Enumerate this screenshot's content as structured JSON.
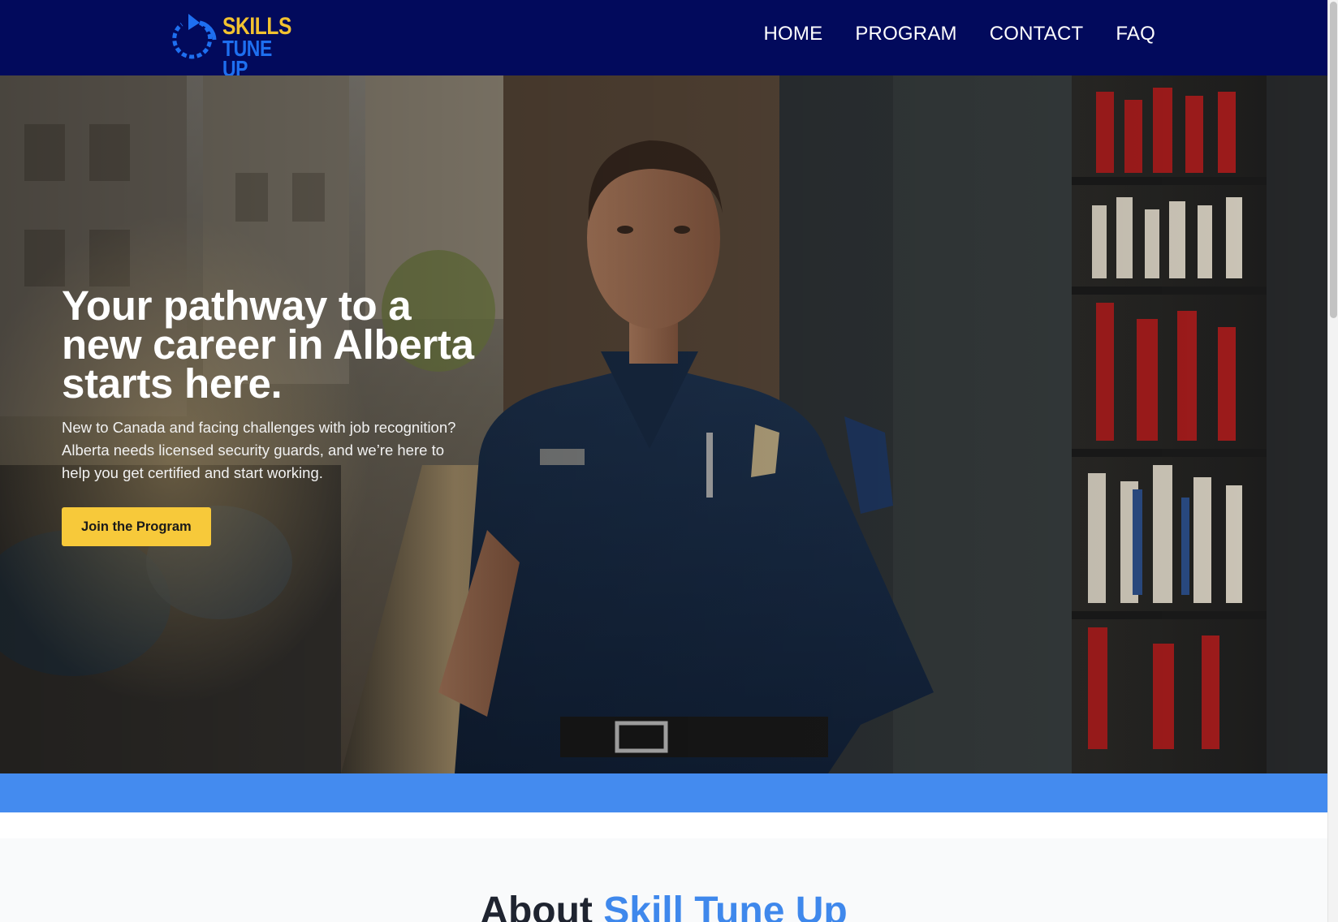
{
  "header": {
    "logo": {
      "line1": "SKILLS",
      "line2": "TUNE UP",
      "icon": "circular-arrow-icon"
    },
    "nav": [
      {
        "label": "HOME"
      },
      {
        "label": "PROGRAM"
      },
      {
        "label": "CONTACT"
      },
      {
        "label": "FAQ"
      }
    ]
  },
  "hero": {
    "title": "Your pathway to a new career in Alberta starts here.",
    "description": "New to Canada and facing challenges with job recognition? Alberta needs licensed security guards, and we’re here to help you get certified and start working.",
    "cta_label": "Join the Program",
    "image": "security-guard-photo"
  },
  "about": {
    "title_prefix": "About ",
    "title_accent": "Skill Tune Up"
  },
  "colors": {
    "header_bg": "#020a5c",
    "logo_yellow": "#f2c230",
    "logo_blue": "#1e6ff0",
    "cta_bg": "#f7c93a",
    "band_blue": "#448bef",
    "accent_blue": "#3f88ec",
    "about_bg": "#f9fafb"
  }
}
